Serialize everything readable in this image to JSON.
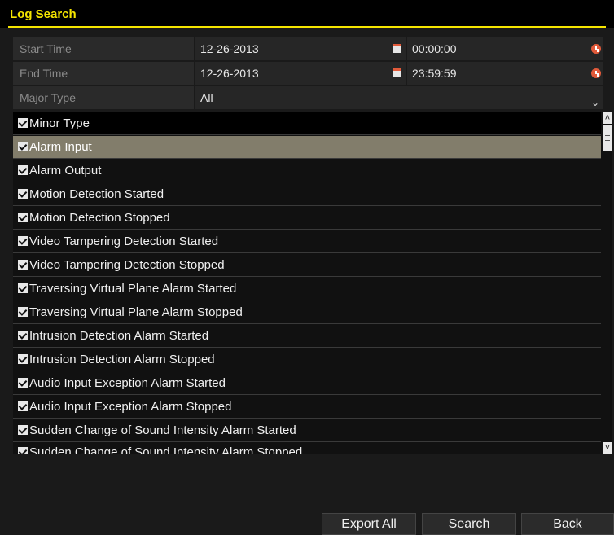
{
  "window": {
    "title": "Log Search"
  },
  "fields": {
    "start_time": {
      "label": "Start Time",
      "date": "12-26-2013",
      "time": "00:00:00"
    },
    "end_time": {
      "label": "End Time",
      "date": "12-26-2013",
      "time": "23:59:59"
    },
    "major_type": {
      "label": "Major Type",
      "value": "All"
    }
  },
  "list": {
    "header": "Minor Type",
    "items": [
      "Alarm Input",
      "Alarm Output",
      "Motion Detection Started",
      "Motion Detection Stopped",
      "Video Tampering Detection Started",
      "Video Tampering Detection Stopped",
      "Traversing Virtual Plane Alarm Started",
      "Traversing Virtual Plane Alarm Stopped",
      "Intrusion Detection Alarm Started",
      "Intrusion Detection Alarm Stopped",
      "Audio Input Exception Alarm Started",
      "Audio Input Exception Alarm Stopped",
      "Sudden Change of Sound Intensity Alarm Started",
      "Sudden Change of Sound Intensity Alarm Stopped"
    ],
    "selected_index": 0
  },
  "buttons": {
    "export_all": "Export All",
    "search": "Search",
    "back": "Back"
  },
  "icons": {
    "calendar": "calendar-icon",
    "clock": "clock-icon",
    "dropdown": "chevron-down-icon"
  },
  "colors": {
    "accent": "#f5e500",
    "selected_row": "#827d6b",
    "icon_red": "#e25a3a"
  }
}
